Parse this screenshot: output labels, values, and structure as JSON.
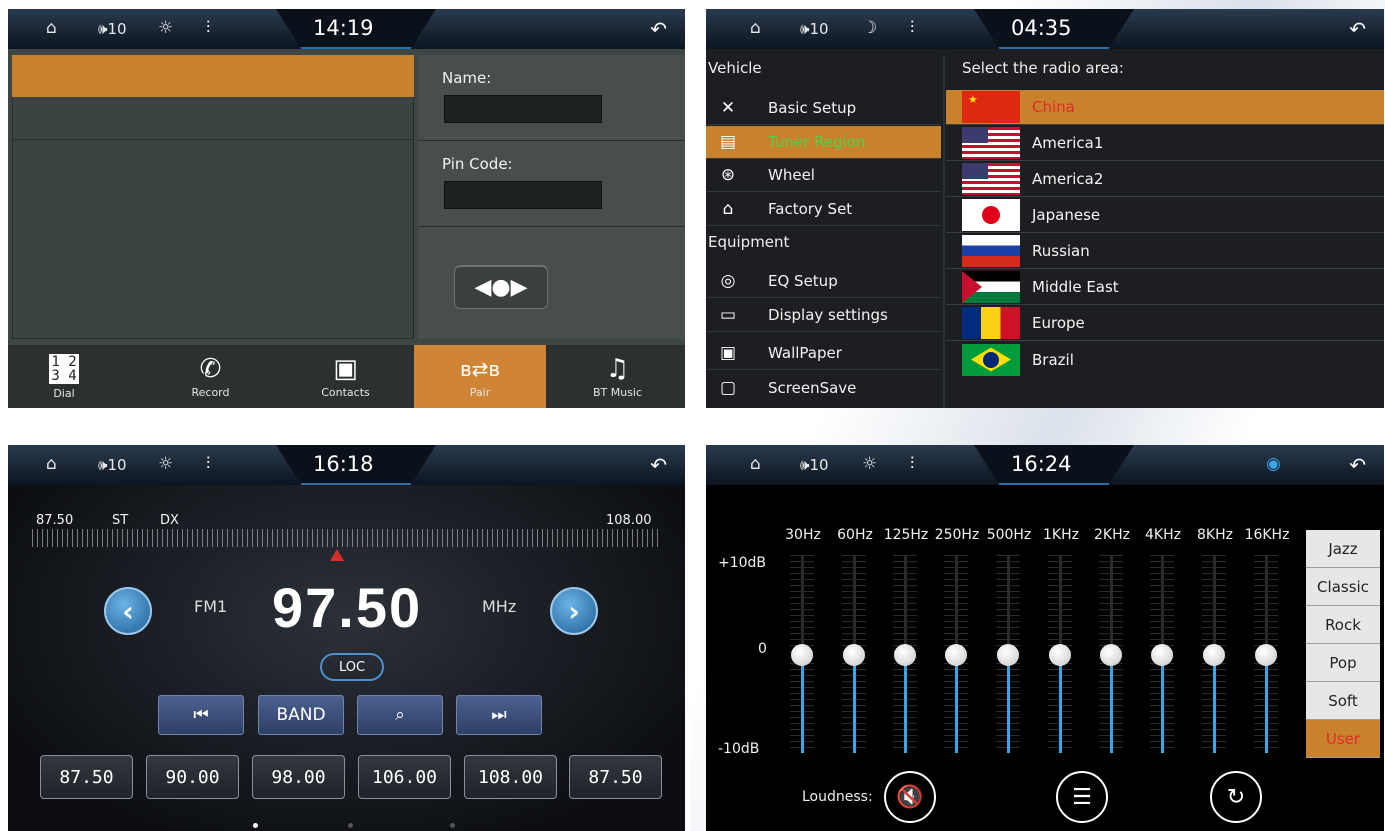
{
  "panels": {
    "phone": {
      "status": {
        "volume": "🕪10",
        "clock": "14:19"
      },
      "name_label": "Name:",
      "name_value": "",
      "pin_label": "Pin Code:",
      "pin_value": "",
      "bottom": [
        {
          "icon": "dial-icon",
          "label": "Dial",
          "active": false
        },
        {
          "icon": "record-icon",
          "label": "Record",
          "active": false
        },
        {
          "icon": "contacts-icon",
          "label": "Contacts",
          "active": false
        },
        {
          "icon": "pair-icon",
          "label": "Pair",
          "active": true
        },
        {
          "icon": "music-icon",
          "label": "BT Music",
          "active": false
        }
      ]
    },
    "settings": {
      "status": {
        "volume": "🕪10",
        "clock": "04:35"
      },
      "group1": "Vehicle",
      "group2": "Equipment",
      "items": [
        {
          "icon": "wrench-icon",
          "label": "Basic Setup",
          "active": false
        },
        {
          "icon": "radio-icon",
          "label": "Tuner Region",
          "active": true
        },
        {
          "icon": "wheel-icon",
          "label": "Wheel",
          "active": false
        },
        {
          "icon": "factory-icon",
          "label": "Factory Set",
          "active": false
        },
        {
          "icon": "eq-icon",
          "label": "EQ Setup",
          "active": false
        },
        {
          "icon": "display-icon",
          "label": "Display settings",
          "active": false
        },
        {
          "icon": "wallpaper-icon",
          "label": "WallPaper",
          "active": false
        },
        {
          "icon": "screensave-icon",
          "label": "ScreenSave",
          "active": false
        }
      ],
      "region_title": "Select the radio area:",
      "regions": [
        {
          "label": "China",
          "selected": true
        },
        {
          "label": "America1",
          "selected": false
        },
        {
          "label": "America2",
          "selected": false
        },
        {
          "label": "Japanese",
          "selected": false
        },
        {
          "label": "Russian",
          "selected": false
        },
        {
          "label": "Middle East",
          "selected": false
        },
        {
          "label": "Europe",
          "selected": false
        },
        {
          "label": "Brazil",
          "selected": false
        }
      ]
    },
    "radio": {
      "status": {
        "volume": "🕪10",
        "clock": "16:18"
      },
      "range_min": "87.50",
      "range_max": "108.00",
      "st": "ST",
      "dx": "DX",
      "band": "FM1",
      "frequency": "97.50",
      "unit": "MHz",
      "loc": "LOC",
      "band_button": "BAND",
      "presets": [
        "87.50",
        "90.00",
        "98.00",
        "106.00",
        "108.00",
        "87.50"
      ]
    },
    "eq": {
      "status": {
        "volume": "🕪10",
        "clock": "16:24"
      },
      "bands": [
        "30Hz",
        "60Hz",
        "125Hz",
        "250Hz",
        "500Hz",
        "1KHz",
        "2KHz",
        "4KHz",
        "8KHz",
        "16KHz"
      ],
      "levels_db": [
        0,
        0,
        0,
        0,
        0,
        0,
        0,
        0,
        0,
        0
      ],
      "db_top": "+10dB",
      "db_mid": "0",
      "db_bottom": "-10dB",
      "presets": [
        {
          "label": "Jazz",
          "active": false
        },
        {
          "label": "Classic",
          "active": false
        },
        {
          "label": "Rock",
          "active": false
        },
        {
          "label": "Pop",
          "active": false
        },
        {
          "label": "Soft",
          "active": false
        },
        {
          "label": "User",
          "active": true
        }
      ],
      "loudness_label": "Loudness:"
    }
  },
  "colors": {
    "accent": "#c9822c",
    "active_text": "#4fd14a",
    "selected_text": "#e02a2a",
    "eq_fill": "#3aa6e8"
  }
}
